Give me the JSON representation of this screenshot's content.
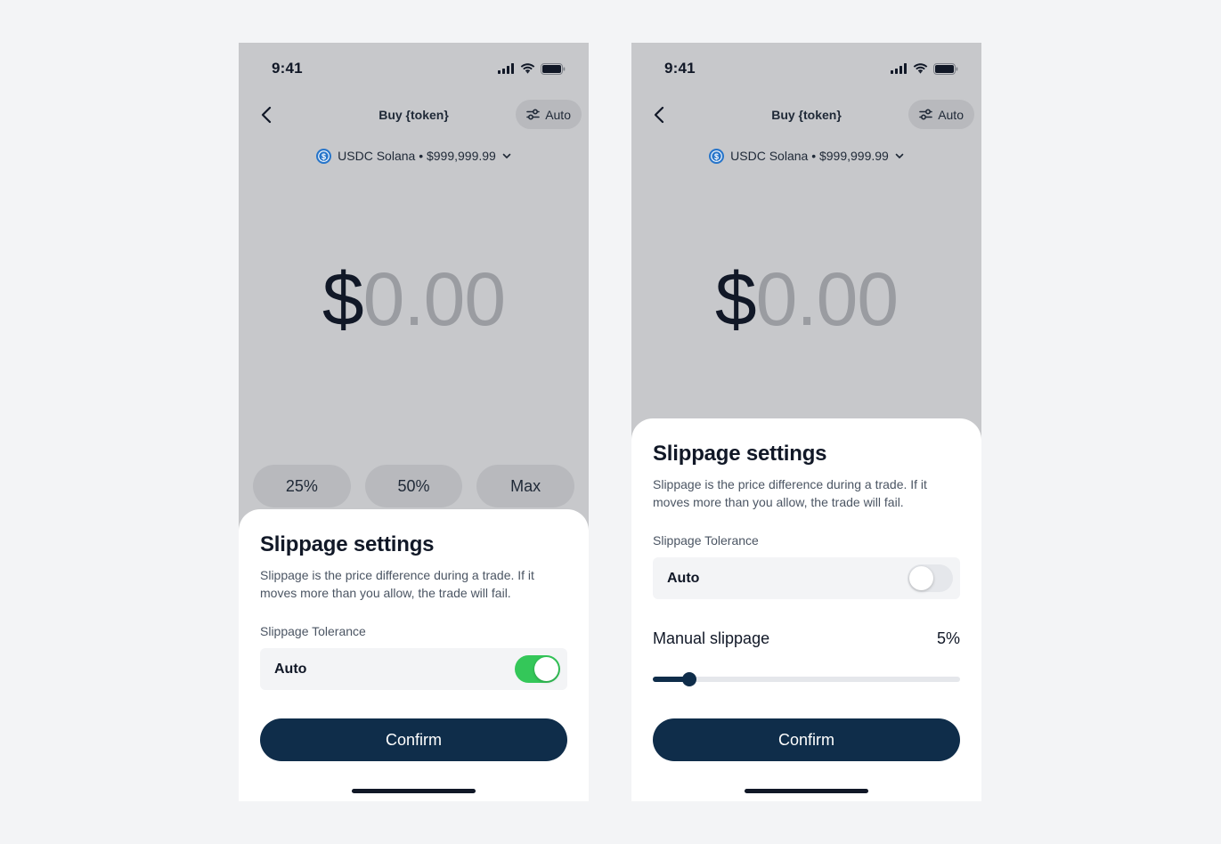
{
  "colors": {
    "page_background": "#f3f4f6",
    "phone_dim_background": "#c7c8cb",
    "primary_navy": "#0f2d4a",
    "toggle_on_green": "#34c759",
    "usdc_blue": "#2775ca"
  },
  "screens": [
    {
      "status_time": "9:41",
      "nav": {
        "back_icon": "chevron-left-icon",
        "title": "Buy {token}",
        "auto_label": "Auto",
        "auto_icon": "sliders-icon"
      },
      "token_selector": {
        "icon": "usdc-icon",
        "label": "USDC Solana • $999,999.99",
        "chevron": "chevron-down-icon"
      },
      "amount": {
        "currency": "$",
        "value": "0.00"
      },
      "percent_buttons": [
        "25%",
        "50%",
        "Max"
      ],
      "sheet": {
        "title": "Slippage settings",
        "description": "Slippage is the price difference during a trade. If it moves more than you allow, the trade will fail.",
        "tolerance_label": "Slippage Tolerance",
        "auto_label": "Auto",
        "auto_enabled": true,
        "confirm_label": "Confirm"
      }
    },
    {
      "status_time": "9:41",
      "nav": {
        "back_icon": "chevron-left-icon",
        "title": "Buy {token}",
        "auto_label": "Auto",
        "auto_icon": "sliders-icon"
      },
      "token_selector": {
        "icon": "usdc-icon",
        "label": "USDC Solana • $999,999.99",
        "chevron": "chevron-down-icon"
      },
      "amount": {
        "currency": "$",
        "value": "0.00"
      },
      "sheet": {
        "title": "Slippage settings",
        "description": "Slippage is the price difference during a trade. If it moves more than you allow, the trade will fail.",
        "tolerance_label": "Slippage Tolerance",
        "auto_label": "Auto",
        "auto_enabled": false,
        "manual_label": "Manual slippage",
        "manual_value": "5%",
        "confirm_label": "Confirm"
      }
    }
  ]
}
